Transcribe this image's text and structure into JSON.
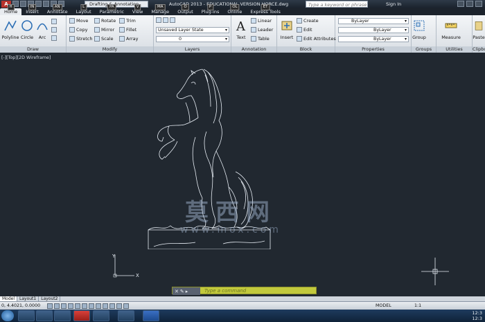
{
  "app": {
    "logo": "A",
    "workspace": "Drafting & Annotation",
    "title": "AutoCAD 2013 - EDUCATIONAL VERSION   HORCE.dwg",
    "search_placeholder": "Type a keyword or phrase",
    "sign_in": "Sign In"
  },
  "tabs": [
    {
      "label": "Home",
      "key": "H"
    },
    {
      "label": "Insert",
      "key": "IN"
    },
    {
      "label": "Annotate",
      "key": "AN"
    },
    {
      "label": "Layout",
      "key": "L"
    },
    {
      "label": "Parametric",
      "key": "PA"
    },
    {
      "label": "View",
      "key": "V"
    },
    {
      "label": "Manage",
      "key": "MA"
    },
    {
      "label": "Output",
      "key": "O"
    },
    {
      "label": "Plug-ins",
      "key": "P"
    },
    {
      "label": "Online",
      "key": "OL"
    },
    {
      "label": "Express Tools",
      "key": "ET"
    }
  ],
  "ribbon": {
    "draw": {
      "title": "Draw",
      "polyline": "Polyline",
      "circle": "Circle",
      "arc": "Arc"
    },
    "modify": {
      "title": "Modify",
      "move": "Move",
      "rotate": "Rotate",
      "trim": "Trim",
      "copy": "Copy",
      "mirror": "Mirror",
      "fillet": "Fillet",
      "stretch": "Stretch",
      "scale": "Scale",
      "array": "Array"
    },
    "layers": {
      "title": "Layers",
      "state": "Unsaved Layer State",
      "current": "0"
    },
    "annotation": {
      "title": "Annotation",
      "text": "Text",
      "linear": "Linear",
      "leader": "Leader",
      "table": "Table"
    },
    "block": {
      "title": "Block",
      "insert": "Insert",
      "create": "Create",
      "edit": "Edit",
      "edit_attributes": "Edit Attributes"
    },
    "properties": {
      "title": "Properties",
      "color": "ByLayer",
      "linetype": "ByLayer",
      "lineweight": "ByLayer"
    },
    "groups": {
      "title": "Groups",
      "group": "Group"
    },
    "utilities": {
      "title": "Utilities",
      "measure": "Measure"
    },
    "clipboard": {
      "title": "Clipbo",
      "paste": "Paste"
    }
  },
  "viewport": {
    "label": "[-][Top][2D Wireframe]"
  },
  "watermark": {
    "cn": "莫西网",
    "url": "www.mox.com"
  },
  "command": {
    "placeholder": "Type a command"
  },
  "layout_tabs": [
    "Model",
    "Layout1",
    "Layout2"
  ],
  "status": {
    "coords": "0, 4.4021, 0.0000",
    "model": "MODEL",
    "scale": "1:1"
  },
  "taskbar": {
    "clock_time": "12:3",
    "clock_date": "12:3"
  },
  "colors": {
    "canvas": "#212830",
    "command_bar": "#c2c93c",
    "horse_stroke": "#e8eef5"
  }
}
